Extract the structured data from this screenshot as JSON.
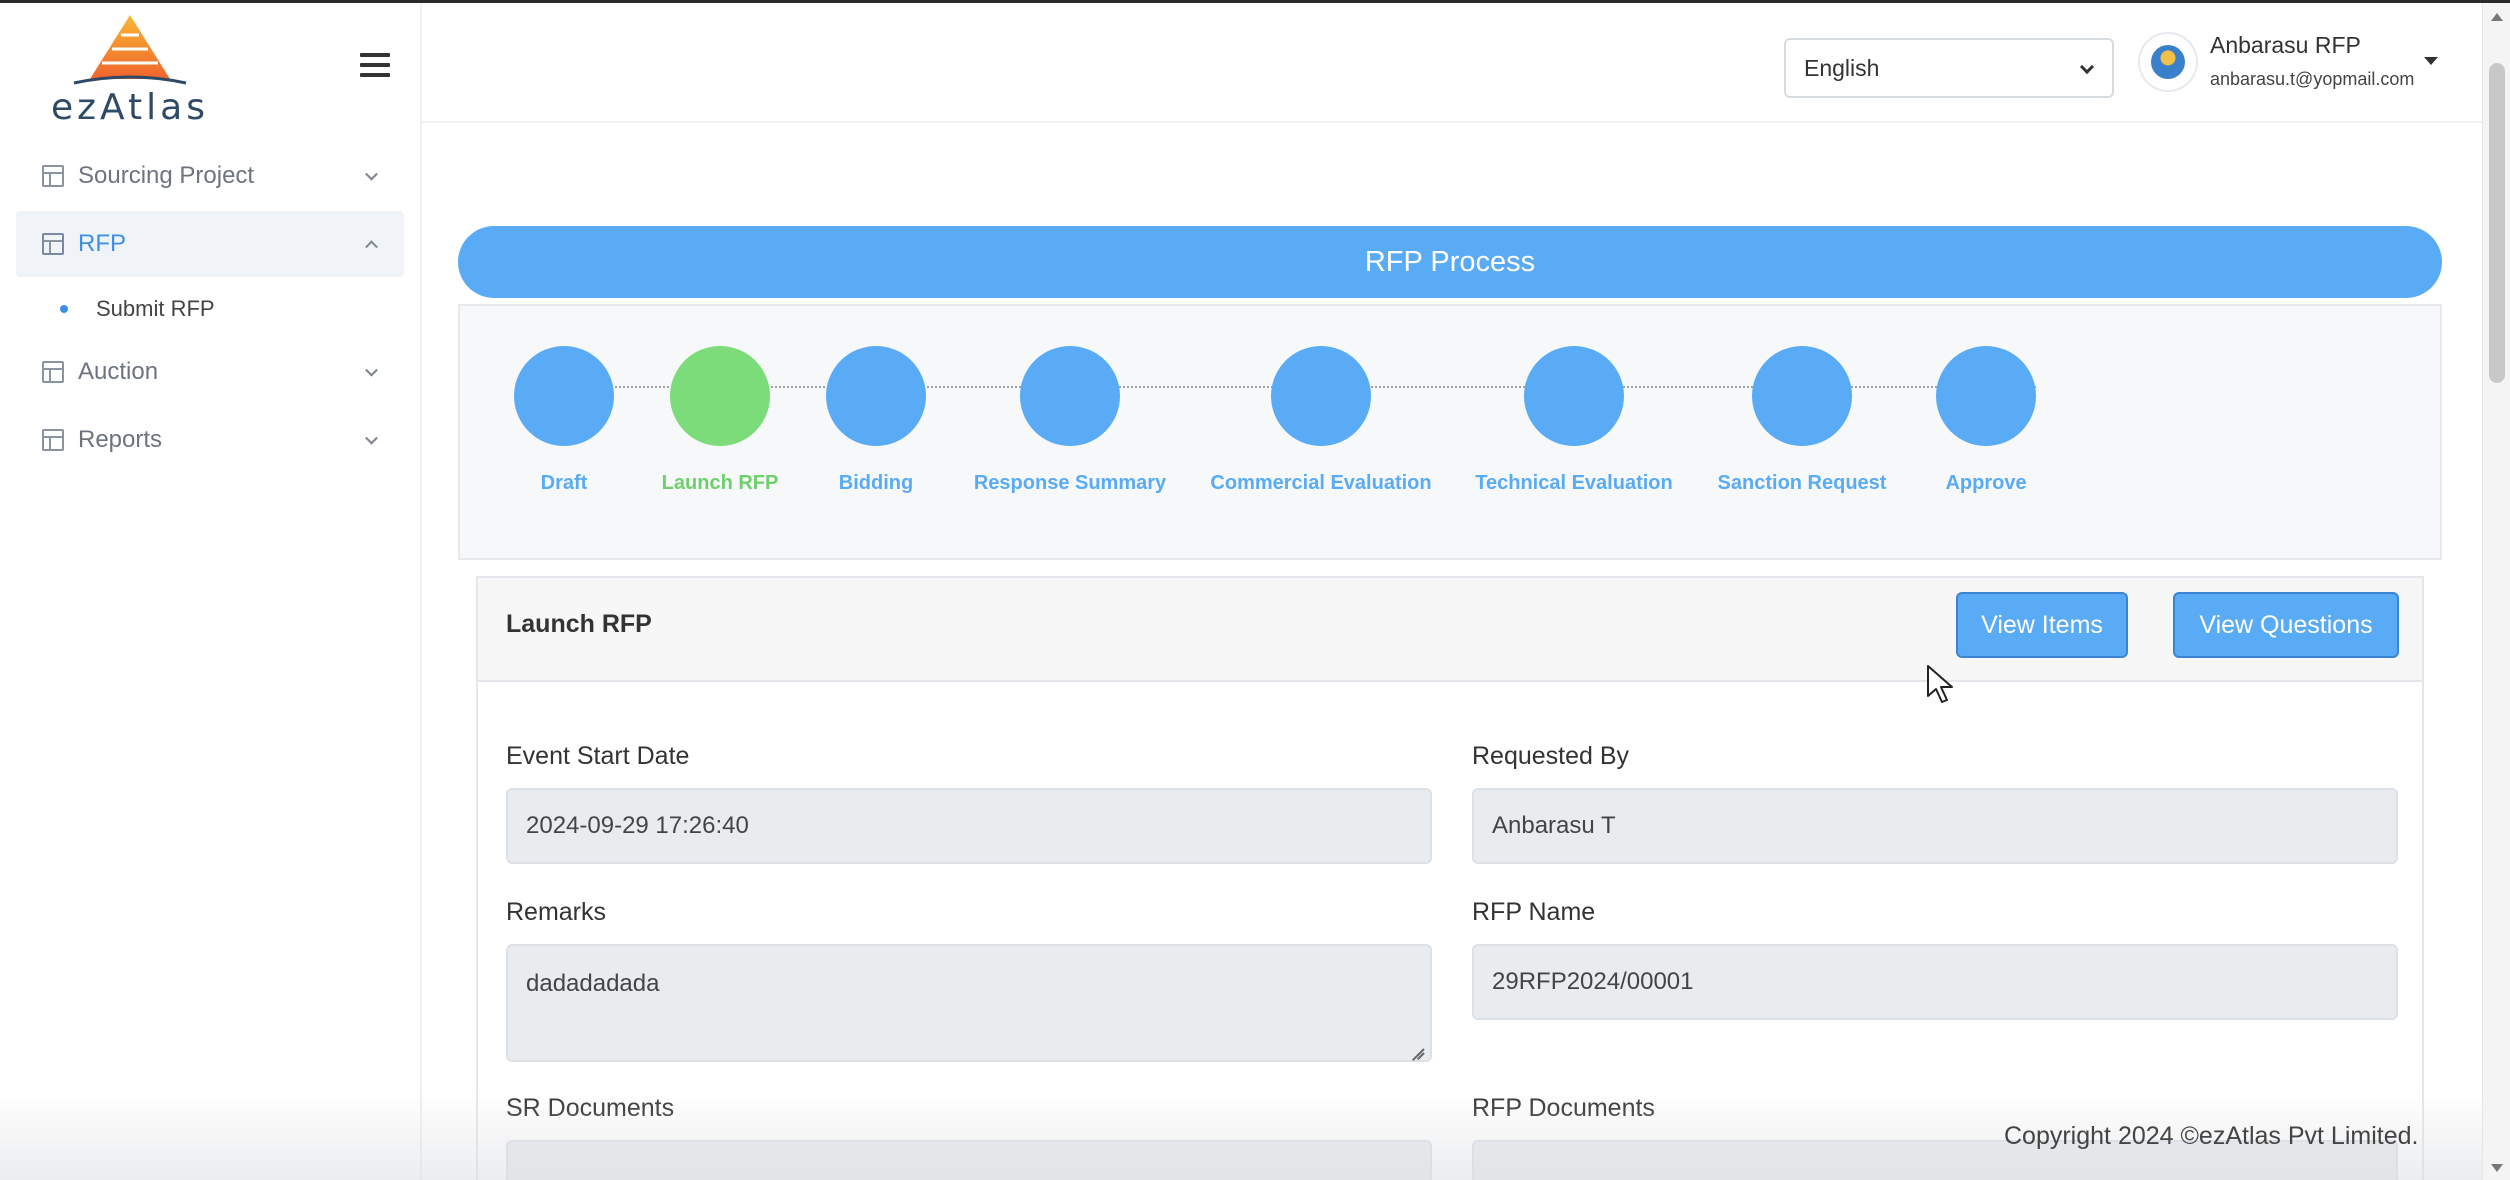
{
  "brand": {
    "name": "ezAtlas"
  },
  "sidebar": {
    "items": [
      {
        "label": "Sourcing Project",
        "expanded": false
      },
      {
        "label": "RFP",
        "expanded": true,
        "active": true,
        "children": [
          {
            "label": "Submit RFP"
          }
        ]
      },
      {
        "label": "Auction",
        "expanded": false
      },
      {
        "label": "Reports",
        "expanded": false
      }
    ]
  },
  "header": {
    "language": {
      "selected": "English"
    },
    "user": {
      "name": "Anbarasu RFP",
      "email": "anbarasu.t@yopmail.com"
    }
  },
  "process": {
    "title": "RFP Process",
    "steps": [
      {
        "label": "Draft",
        "status": "pending"
      },
      {
        "label": "Launch RFP",
        "status": "current"
      },
      {
        "label": "Bidding",
        "status": "pending"
      },
      {
        "label": "Response Summary",
        "status": "pending"
      },
      {
        "label": "Commercial Evaluation",
        "status": "pending"
      },
      {
        "label": "Technical Evaluation",
        "status": "pending"
      },
      {
        "label": "Sanction Request",
        "status": "pending"
      },
      {
        "label": "Approve",
        "status": "pending"
      }
    ]
  },
  "card": {
    "title": "Launch RFP",
    "buttons": {
      "view_items": "View Items",
      "view_questions": "View Questions"
    },
    "fields": {
      "event_start_date": {
        "label": "Event Start Date",
        "value": "2024-09-29 17:26:40"
      },
      "requested_by": {
        "label": "Requested By",
        "value": "Anbarasu T"
      },
      "remarks": {
        "label": "Remarks",
        "value": "dadadadada"
      },
      "rfp_name": {
        "label": "RFP Name",
        "value": "29RFP2024/00001"
      },
      "sr_documents": {
        "label": "SR Documents"
      },
      "rfp_documents": {
        "label": "RFP Documents"
      }
    }
  },
  "footer": {
    "copyright": "Copyright 2024 ©ezAtlas Pvt Limited."
  },
  "colors": {
    "accent": "#5aabf5",
    "success": "#7ddc7a",
    "active_nav": "#3d8fe8"
  }
}
